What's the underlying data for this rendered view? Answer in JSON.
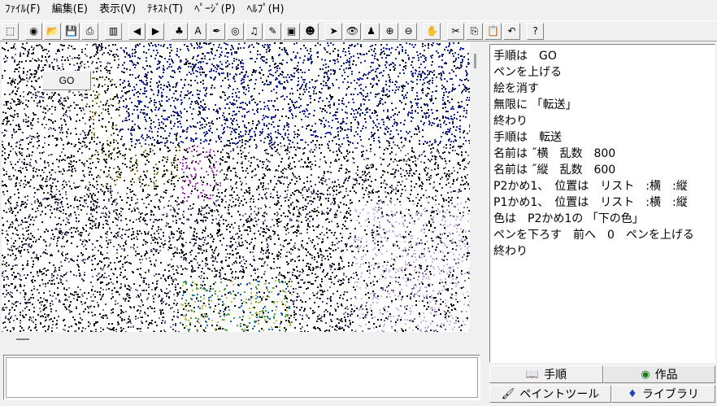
{
  "menu": [
    "ﾌｧｲﾙ(F)",
    "編集(E)",
    "表示(V)",
    "ﾃｷｽﾄ(T)",
    "ﾍﾟｰｼﾞ(P)",
    "ﾍﾙﾌﾟ(H)"
  ],
  "toolbar": {
    "groups": [
      [
        {
          "name": "new-page-icon",
          "glyph": "⬚"
        }
      ],
      [
        {
          "name": "globe-icon",
          "glyph": "◉"
        },
        {
          "name": "open-folder-icon",
          "glyph": "📂"
        },
        {
          "name": "save-icon",
          "glyph": "💾"
        },
        {
          "name": "print-icon",
          "glyph": "⎙"
        }
      ],
      [
        {
          "name": "layout-icon",
          "glyph": "▥"
        }
      ],
      [
        {
          "name": "back-arrow-icon",
          "glyph": "◀"
        },
        {
          "name": "forward-arrow-icon",
          "glyph": "▶"
        }
      ],
      [
        {
          "name": "turtle-icon",
          "glyph": "♣"
        },
        {
          "name": "text-icon",
          "glyph": "A"
        },
        {
          "name": "pen-tool-icon",
          "glyph": "✒"
        },
        {
          "name": "eye-red-icon",
          "glyph": "◎"
        },
        {
          "name": "music-note-icon",
          "glyph": "♫"
        },
        {
          "name": "pencil-icon",
          "glyph": "✎"
        },
        {
          "name": "camera-icon",
          "glyph": "▣"
        },
        {
          "name": "head-icon",
          "glyph": "☻"
        }
      ],
      [
        {
          "name": "pointer-icon",
          "glyph": "➤"
        },
        {
          "name": "eye-icon",
          "glyph": "👁"
        },
        {
          "name": "stamp-icon",
          "glyph": "♟"
        },
        {
          "name": "zoom-in-icon",
          "glyph": "⊕"
        },
        {
          "name": "zoom-out-icon",
          "glyph": "⊖"
        }
      ],
      [
        {
          "name": "stop-hand-icon",
          "glyph": "✋"
        }
      ],
      [
        {
          "name": "cut-icon",
          "glyph": "✂"
        },
        {
          "name": "copy-icon",
          "glyph": "⎘"
        },
        {
          "name": "paste-icon",
          "glyph": "📋"
        },
        {
          "name": "undo-icon",
          "glyph": "↶"
        }
      ],
      [
        {
          "name": "help-icon",
          "glyph": "?"
        }
      ]
    ]
  },
  "canvas": {
    "go_button_label": "GO"
  },
  "code_lines": [
    "手順は　GO",
    "ペンを上げる",
    "絵を消す",
    "無限に 「転送」",
    "終わり",
    "手順は　転送",
    "名前は ˝横　乱数　800",
    "名前は ˝縦　乱数　600",
    "P2かめ1、　位置は　リスト　:横　:縦",
    "P1かめ1、　位置は　リスト　:横　:縦",
    "色は　P2かめ1の 「下の色」",
    "ペンを下ろす　前へ　0　ペンを上げる",
    "終わり"
  ],
  "tabs": {
    "procedures": "手順",
    "works": "作品",
    "paint_tool": "ペイントツール",
    "library": "ライブラリ"
  }
}
